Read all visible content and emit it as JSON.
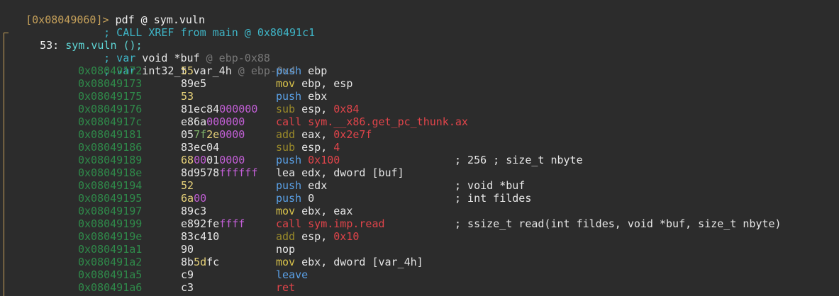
{
  "prompt": {
    "address": "[0x08049060]>",
    "command": " pdf @ sym.vuln"
  },
  "xref": "; CALL XREF from main @ 0x80491c1",
  "function": {
    "size": "53:",
    "name": "sym.vuln ();"
  },
  "vars": [
    {
      "kw": "; var",
      "decl": " void *buf",
      "loc": " @ ebp-0x88"
    },
    {
      "kw": "; var",
      "decl": " int32_t var_4h",
      "loc": " @ ebp-0x4"
    }
  ],
  "rows": [
    {
      "addr": "0x08049172",
      "bytes": [
        [
          "55",
          "b-yellow"
        ]
      ],
      "mn": "push",
      "mnc": "mn-push",
      "ops": [
        [
          " ebp",
          "op"
        ]
      ],
      "cmt": ""
    },
    {
      "addr": "0x08049173",
      "bytes": [
        [
          "89e5",
          "b-norm"
        ]
      ],
      "mn": "mov",
      "mnc": "mn-mov",
      "ops": [
        [
          " ebp, esp",
          "op"
        ]
      ],
      "cmt": ""
    },
    {
      "addr": "0x08049175",
      "bytes": [
        [
          "53",
          "b-yellow"
        ]
      ],
      "mn": "push",
      "mnc": "mn-push",
      "ops": [
        [
          " ebx",
          "op"
        ]
      ],
      "cmt": ""
    },
    {
      "addr": "0x08049176",
      "bytes": [
        [
          "81ec84",
          "b-norm"
        ],
        [
          "000000",
          "b-magenta"
        ]
      ],
      "mn": "sub",
      "mnc": "mn-sub",
      "ops": [
        [
          " esp, ",
          "op"
        ],
        [
          "0x84",
          "op-num"
        ]
      ],
      "cmt": ""
    },
    {
      "addr": "0x0804917c",
      "bytes": [
        [
          "e86a",
          "b-norm"
        ],
        [
          "000000",
          "b-magenta"
        ]
      ],
      "mn": "call",
      "mnc": "mn-call",
      "ops": [
        [
          " sym.__x86.get_pc_thunk.ax",
          "op-sym"
        ]
      ],
      "cmt": ""
    },
    {
      "addr": "0x08049181",
      "bytes": [
        [
          "05",
          "b-norm"
        ],
        [
          "7f",
          "b-green"
        ],
        [
          "2e",
          "b-yellow"
        ],
        [
          "0000",
          "b-magenta"
        ]
      ],
      "mn": "add",
      "mnc": "mn-add",
      "ops": [
        [
          " eax, ",
          "op"
        ],
        [
          "0x2e7f",
          "op-num"
        ]
      ],
      "cmt": ""
    },
    {
      "addr": "0x08049186",
      "bytes": [
        [
          "83ec04",
          "b-norm"
        ]
      ],
      "mn": "sub",
      "mnc": "mn-sub",
      "ops": [
        [
          " esp, ",
          "op"
        ],
        [
          "4",
          "op-num"
        ]
      ],
      "cmt": ""
    },
    {
      "addr": "0x08049189",
      "bytes": [
        [
          "68",
          "b-yellow"
        ],
        [
          "00",
          "b-magenta"
        ],
        [
          "01",
          "b-norm"
        ],
        [
          "0000",
          "b-magenta"
        ]
      ],
      "mn": "push",
      "mnc": "mn-push",
      "ops": [
        [
          " ",
          "op"
        ],
        [
          "0x100",
          "op-num"
        ]
      ],
      "cmt": "; 256 ; size_t nbyte"
    },
    {
      "addr": "0x0804918e",
      "bytes": [
        [
          "8d9578",
          "b-norm"
        ],
        [
          "ffffff",
          "b-magenta"
        ]
      ],
      "mn": "lea",
      "mnc": "mn-lea",
      "ops": [
        [
          " edx, dword [buf]",
          "op"
        ]
      ],
      "cmt": ""
    },
    {
      "addr": "0x08049194",
      "bytes": [
        [
          "52",
          "b-yellow"
        ]
      ],
      "mn": "push",
      "mnc": "mn-push",
      "ops": [
        [
          " edx",
          "op"
        ]
      ],
      "cmt": "; void *buf"
    },
    {
      "addr": "0x08049195",
      "bytes": [
        [
          "6a",
          "b-yellow"
        ],
        [
          "00",
          "b-magenta"
        ]
      ],
      "mn": "push",
      "mnc": "mn-push",
      "ops": [
        [
          " 0",
          "op"
        ]
      ],
      "cmt": "; int fildes"
    },
    {
      "addr": "0x08049197",
      "bytes": [
        [
          "89c3",
          "b-norm"
        ]
      ],
      "mn": "mov",
      "mnc": "mn-mov",
      "ops": [
        [
          " ebx, eax",
          "op"
        ]
      ],
      "cmt": ""
    },
    {
      "addr": "0x08049199",
      "bytes": [
        [
          "e892fe",
          "b-norm"
        ],
        [
          "ffff",
          "b-magenta"
        ]
      ],
      "mn": "call",
      "mnc": "mn-call",
      "ops": [
        [
          " sym.imp.read",
          "op-sym"
        ]
      ],
      "cmt": "; ssize_t read(int fildes, void *buf, size_t nbyte)"
    },
    {
      "addr": "0x0804919e",
      "bytes": [
        [
          "83c410",
          "b-norm"
        ]
      ],
      "mn": "add",
      "mnc": "mn-add",
      "ops": [
        [
          " esp, ",
          "op"
        ],
        [
          "0x10",
          "op-num"
        ]
      ],
      "cmt": ""
    },
    {
      "addr": "0x080491a1",
      "bytes": [
        [
          "90",
          "b-norm"
        ]
      ],
      "mn": "nop",
      "mnc": "mn-nop",
      "ops": [],
      "cmt": ""
    },
    {
      "addr": "0x080491a2",
      "bytes": [
        [
          "8b",
          "b-norm"
        ],
        [
          "5d",
          "b-yellow"
        ],
        [
          "fc",
          "b-norm"
        ]
      ],
      "mn": "mov",
      "mnc": "mn-mov",
      "ops": [
        [
          " ebx, dword [var_4h]",
          "op"
        ]
      ],
      "cmt": ""
    },
    {
      "addr": "0x080491a5",
      "bytes": [
        [
          "c9",
          "b-norm"
        ]
      ],
      "mn": "leave",
      "mnc": "mn-leave",
      "ops": [],
      "cmt": ""
    },
    {
      "addr": "0x080491a6",
      "bytes": [
        [
          "c3",
          "b-norm"
        ]
      ],
      "mn": "ret",
      "mnc": "mn-ret",
      "ops": [],
      "cmt": ""
    }
  ]
}
